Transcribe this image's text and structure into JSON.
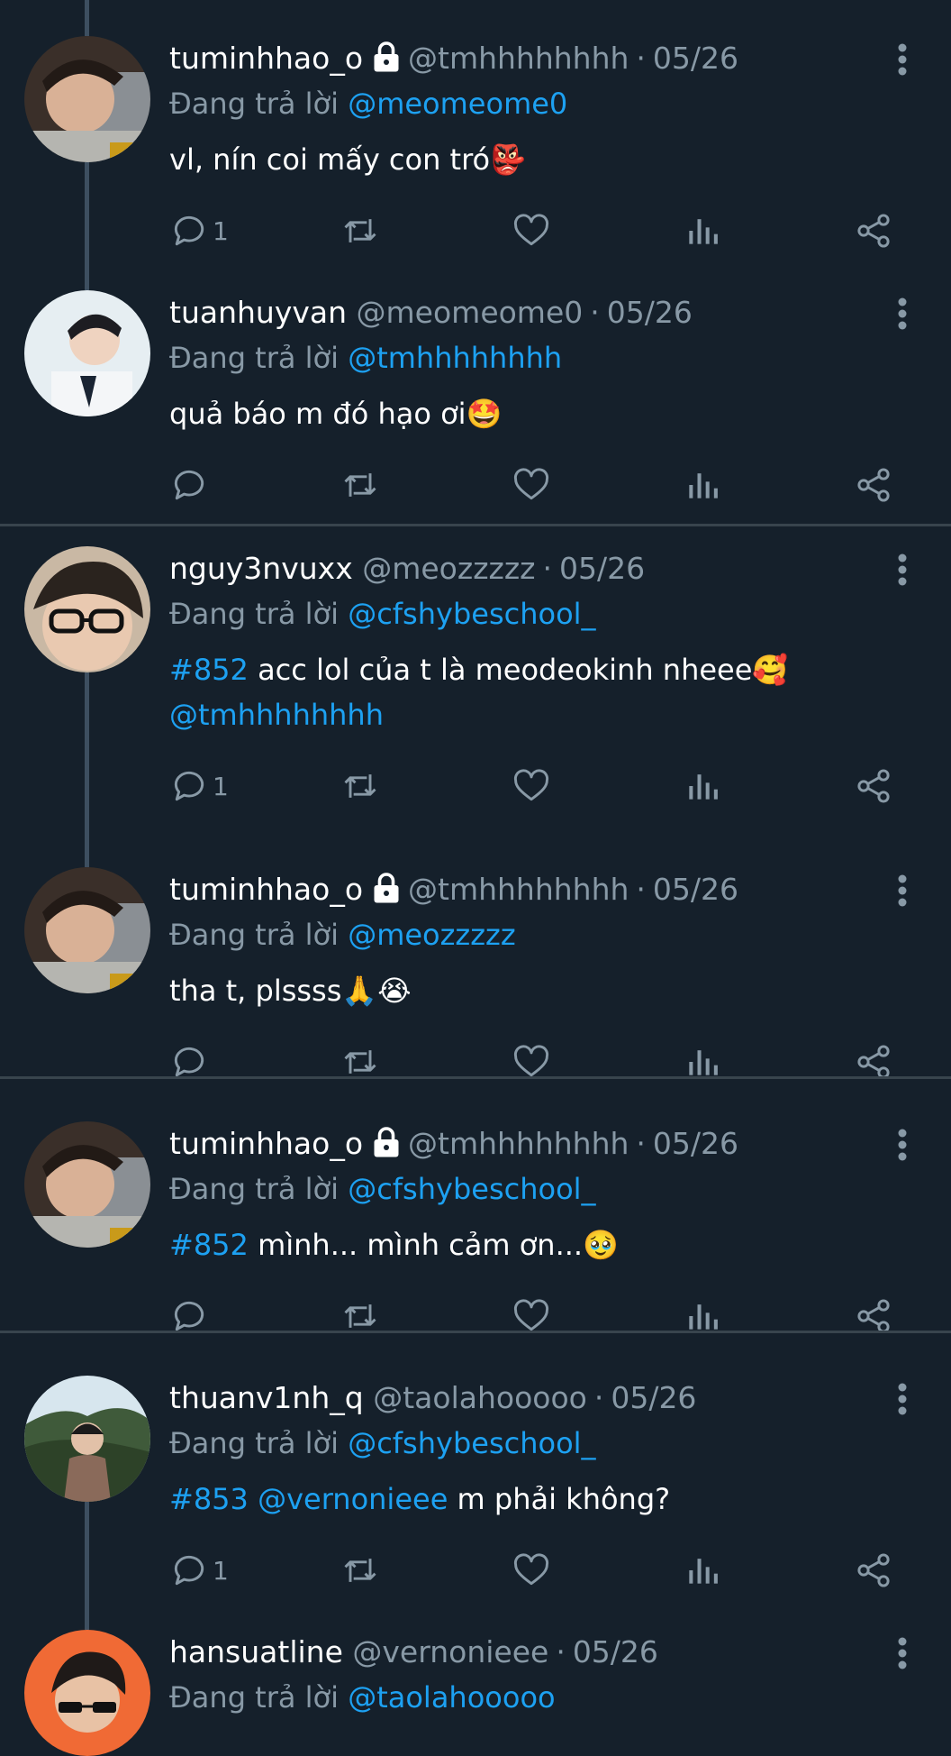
{
  "colors": {
    "background": "#15202b",
    "text": "#ffffff",
    "muted": "#8899a6",
    "accent": "#1da1f2",
    "divider": "#38444d"
  },
  "reply_prefix": "Đang trả lời",
  "tweets": [
    {
      "name": "tuminhhao_o",
      "protected": true,
      "handle": "@tmhhhhhhhh",
      "date": "05/26",
      "reply_to": "@meomeome0",
      "text": "vl, nín coi mấy con tró👺",
      "reply_count": "1"
    },
    {
      "name": "tuanhuyvan",
      "protected": false,
      "handle": "@meomeome0",
      "date": "05/26",
      "reply_to": "@tmhhhhhhhh",
      "text": "quả báo m đó hạo ơi🤩",
      "reply_count": ""
    },
    {
      "name": "nguy3nvuxx",
      "protected": false,
      "handle": "@meozzzzz",
      "date": "05/26",
      "reply_to": "@cfshybeschool_",
      "hashtag": "#852",
      "text": " acc lol của t là meodeokinh nheee🥰",
      "mention_line": "@tmhhhhhhhh",
      "reply_count": "1"
    },
    {
      "name": "tuminhhao_o",
      "protected": true,
      "handle": "@tmhhhhhhhh",
      "date": "05/26",
      "reply_to": "@meozzzzz",
      "text": "tha t, plssss🙏😭",
      "reply_count": ""
    },
    {
      "name": "tuminhhao_o",
      "protected": true,
      "handle": "@tmhhhhhhhh",
      "date": "05/26",
      "reply_to": "@cfshybeschool_",
      "hashtag": "#852",
      "text": " mình... mình cảm ơn...🥹",
      "reply_count": ""
    },
    {
      "name": "thuanv1nh_q",
      "protected": false,
      "handle": "@taolahooooo",
      "date": "05/26",
      "reply_to": "@cfshybeschool_",
      "hashtag": "#853",
      "mention_inline": "@vernonieee",
      "text": " m phải không?",
      "reply_count": "1"
    },
    {
      "name": "hansuatline",
      "protected": false,
      "handle": "@vernonieee",
      "date": "05/26",
      "reply_to": "@taolahooooo",
      "text": "",
      "reply_count": ""
    }
  ]
}
